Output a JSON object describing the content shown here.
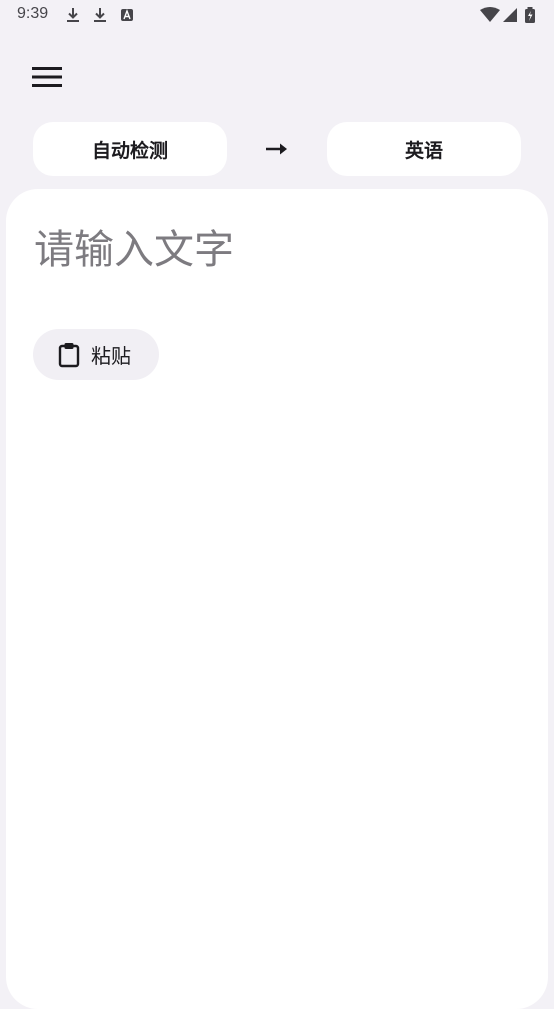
{
  "status_bar": {
    "time": "9:39",
    "left_icons": [
      "download-icon",
      "download-icon",
      "translate-app-icon"
    ],
    "right_icons": [
      "wifi-icon",
      "signal-icon",
      "battery-icon"
    ]
  },
  "toolbar": {
    "menu_icon": "hamburger-menu-icon"
  },
  "languages": {
    "source": "自动检测",
    "target": "英语",
    "arrow_icon": "arrow-right-icon"
  },
  "input": {
    "placeholder": "请输入文字",
    "value": ""
  },
  "paste": {
    "label": "粘贴",
    "icon": "clipboard-icon"
  },
  "colors": {
    "background": "#f3f1f6",
    "card": "#ffffff",
    "pill": "#ffffff",
    "paste_chip": "#f1eff4",
    "text": "#1c1b1f",
    "placeholder": "#7d7b80"
  }
}
